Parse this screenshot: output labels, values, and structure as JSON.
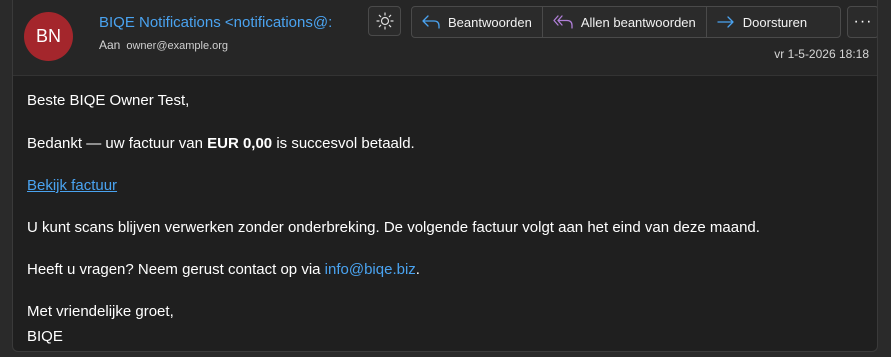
{
  "header": {
    "avatar_initials": "BN",
    "avatar_color": "#a4262c",
    "sender": "BIQE Notifications <notifications@:",
    "to_label": "Aan",
    "to_address": "owner@example.org",
    "date": "vr 1-5-2026 18:18"
  },
  "toolbar": {
    "theme_icon": "sun-icon",
    "reply_label": "Beantwoorden",
    "reply_all_label": "Allen beantwoorden",
    "forward_label": "Doorsturen",
    "more_label": "···"
  },
  "email": {
    "greeting": "Beste BIQE Owner Test,",
    "thanks_prefix": "Bedankt — uw factuur van ",
    "thanks_amount": "EUR 0,00",
    "thanks_suffix": " is succesvol betaald.",
    "invoice_link": "Bekijk factuur",
    "continue_text": "U kunt scans blijven verwerken zonder onderbreking. De volgende factuur volgt aan het eind van deze maand.",
    "questions_prefix": "Heeft u vragen? Neem gerust contact op via ",
    "contact_email": "info@biqe.biz",
    "questions_suffix": ".",
    "closing": "Met vriendelijke groet,",
    "signature": "BIQE"
  },
  "colors": {
    "link": "#4aa3f0",
    "background": "#1f1f1f"
  }
}
